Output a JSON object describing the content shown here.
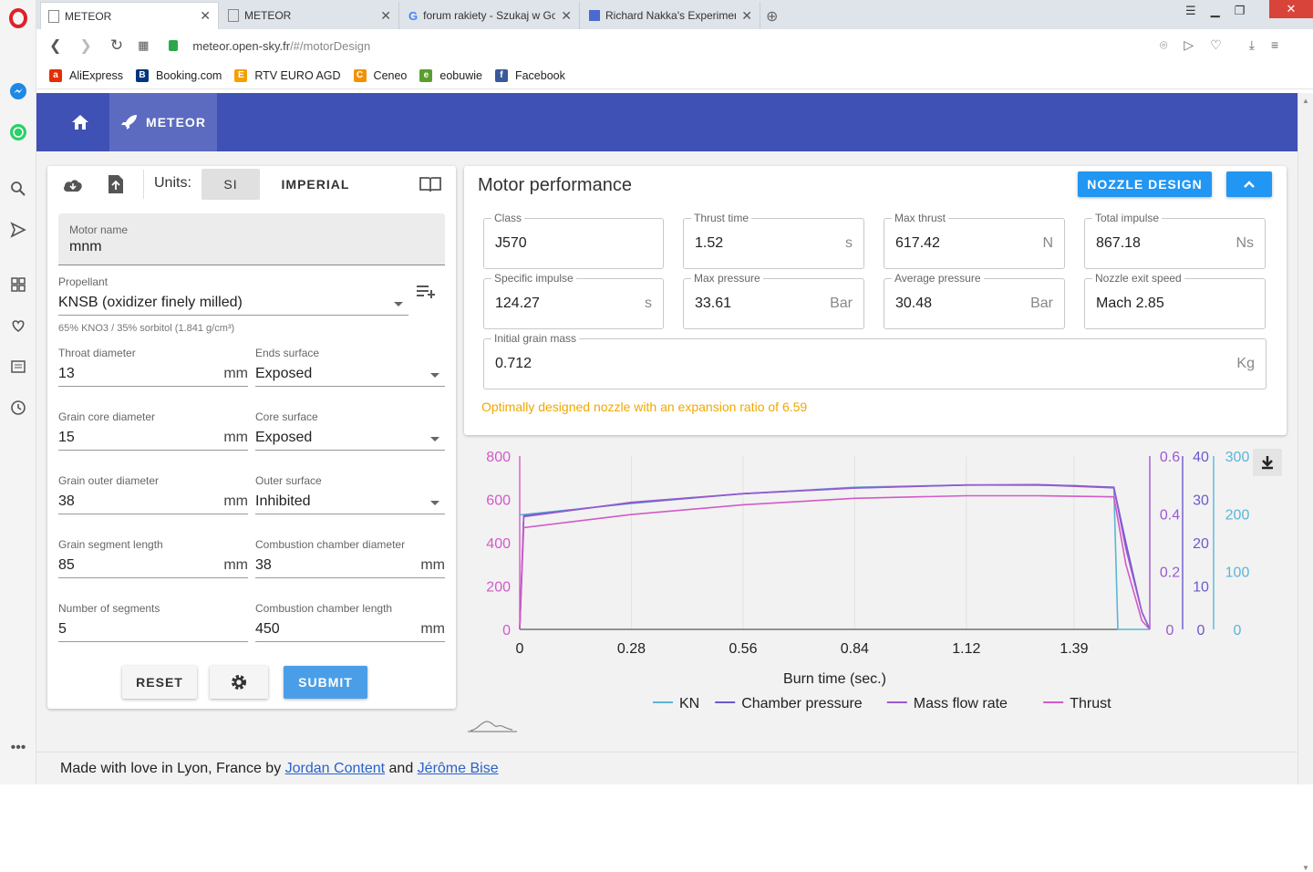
{
  "browser": {
    "tabs": [
      {
        "title": "METEOR",
        "active": true
      },
      {
        "title": "METEOR",
        "active": false
      },
      {
        "title": "forum rakiety - Szukaj w Go",
        "active": false
      },
      {
        "title": "Richard Nakka's Experimen",
        "active": false
      }
    ],
    "url_host": "meteor.open-sky.fr",
    "url_path": "/#/motorDesign",
    "bookmarks": [
      {
        "label": "AliExpress",
        "color": "#e62e04",
        "glyph": "a"
      },
      {
        "label": "Booking.com",
        "color": "#003580",
        "glyph": "B"
      },
      {
        "label": "RTV EURO AGD",
        "color": "#f5a000",
        "glyph": "E"
      },
      {
        "label": "Ceneo",
        "color": "#f39200",
        "glyph": "C"
      },
      {
        "label": "eobuwie",
        "color": "#5a9e2f",
        "glyph": "e"
      },
      {
        "label": "Facebook",
        "color": "#3b5998",
        "glyph": "f"
      }
    ]
  },
  "app": {
    "brand": "METEOR",
    "accent": "#3f51b5",
    "button_blue": "#2196f3"
  },
  "design": {
    "units_label": "Units:",
    "units_si": "SI",
    "units_imperial": "IMPERIAL",
    "motor_name_label": "Motor name",
    "motor_name": "mnm",
    "propellant_label": "Propellant",
    "propellant": "KNSB (oxidizer finely milled)",
    "propellant_desc": "65% KNO3 / 35% sorbitol (1.841 g/cm³)",
    "throat_label": "Throat diameter",
    "throat": "13",
    "throat_unit": "mm",
    "ends_label": "Ends surface",
    "ends": "Exposed",
    "core_label": "Grain core diameter",
    "core": "15",
    "core_unit": "mm",
    "core_surface_label": "Core surface",
    "core_surface": "Exposed",
    "outer_label": "Grain outer diameter",
    "outer": "38",
    "outer_unit": "mm",
    "outer_surface_label": "Outer surface",
    "outer_surface": "Inhibited",
    "seglen_label": "Grain segment length",
    "seglen": "85",
    "seglen_unit": "mm",
    "ccd_label": "Combustion chamber diameter",
    "ccd": "38",
    "ccd_unit": "mm",
    "segnum_label": "Number of segments",
    "segnum": "5",
    "ccl_label": "Combustion chamber length",
    "ccl": "450",
    "ccl_unit": "mm",
    "reset": "RESET",
    "submit": "SUBMIT"
  },
  "performance": {
    "title": "Motor performance",
    "nozzle_btn": "NOZZLE DESIGN",
    "class_label": "Class",
    "class": "J570",
    "thrust_time_label": "Thrust time",
    "thrust_time": "1.52",
    "thrust_time_unit": "s",
    "max_thrust_label": "Max thrust",
    "max_thrust": "617.42",
    "max_thrust_unit": "N",
    "total_impulse_label": "Total impulse",
    "total_impulse": "867.18",
    "total_impulse_unit": "Ns",
    "isp_label": "Specific impulse",
    "isp": "124.27",
    "isp_unit": "s",
    "max_pressure_label": "Max pressure",
    "max_pressure": "33.61",
    "max_pressure_unit": "Bar",
    "avg_pressure_label": "Average pressure",
    "avg_pressure": "30.48",
    "avg_pressure_unit": "Bar",
    "exit_speed_label": "Nozzle exit speed",
    "exit_speed": "Mach 2.85",
    "grain_mass_label": "Initial grain mass",
    "grain_mass": "0.712",
    "grain_mass_unit": "Kg",
    "message": "Optimally designed nozzle with an expansion ratio of 6.59"
  },
  "chart_data": {
    "type": "line",
    "xlabel": "Burn time (sec.)",
    "x_ticks": [
      "0",
      "0.28",
      "0.56",
      "0.84",
      "1.12",
      "1.39"
    ],
    "xlim": [
      0,
      1.58
    ],
    "axes": [
      {
        "name": "Thrust",
        "ticks": [
          "800",
          "600",
          "400",
          "200",
          "0"
        ],
        "range": [
          0,
          800
        ],
        "color": "#d25ac8"
      },
      {
        "name": "Mass flow rate",
        "ticks": [
          "0.6",
          "0.4",
          "0.2",
          "0"
        ],
        "range": [
          0,
          0.6
        ],
        "color": "#9b59d0"
      },
      {
        "name": "Chamber pressure",
        "ticks": [
          "40",
          "30",
          "20",
          "10",
          "0"
        ],
        "range": [
          0,
          40
        ],
        "color": "#6a5acd"
      },
      {
        "name": "KN",
        "ticks": [
          "300",
          "200",
          "100",
          "0"
        ],
        "range": [
          0,
          300
        ],
        "color": "#5bb5d8"
      }
    ],
    "series": [
      {
        "name": "KN",
        "color": "#5bb5d8",
        "axis": 3,
        "x": [
          0,
          0.28,
          0.56,
          0.84,
          1.12,
          1.39,
          1.49,
          1.5,
          1.58
        ],
        "values": [
          198,
          218,
          235,
          246,
          250,
          249,
          245,
          0,
          0
        ]
      },
      {
        "name": "Chamber pressure",
        "color": "#6a5acd",
        "x": [
          0,
          0.01,
          0.28,
          0.56,
          0.84,
          1.12,
          1.3,
          1.49,
          1.52,
          1.56,
          1.58
        ],
        "axis": 2,
        "values": [
          0,
          26.2,
          29.2,
          31.3,
          32.6,
          33.3,
          33.4,
          32.8,
          20,
          4,
          0
        ]
      },
      {
        "name": "Mass flow rate",
        "color": "#9b59d0",
        "axis": 1,
        "x": [
          0,
          0.01,
          0.28,
          0.56,
          0.84,
          1.12,
          1.3,
          1.49,
          1.52,
          1.56,
          1.58
        ],
        "values": [
          0,
          0.39,
          0.44,
          0.47,
          0.49,
          0.5,
          0.5,
          0.49,
          0.28,
          0.06,
          0
        ]
      },
      {
        "name": "Thrust",
        "color": "#d25ac8",
        "axis": 0,
        "x": [
          0,
          0.01,
          0.28,
          0.56,
          0.84,
          1.12,
          1.3,
          1.49,
          1.52,
          1.56,
          1.58
        ],
        "values": [
          0,
          470,
          530,
          575,
          605,
          617,
          617,
          612,
          300,
          40,
          0
        ]
      }
    ]
  },
  "footer": {
    "prefix": "Made with love in Lyon, France by",
    "author1": "Jordan Content",
    "and": "and",
    "author2": "Jérôme Bise"
  }
}
